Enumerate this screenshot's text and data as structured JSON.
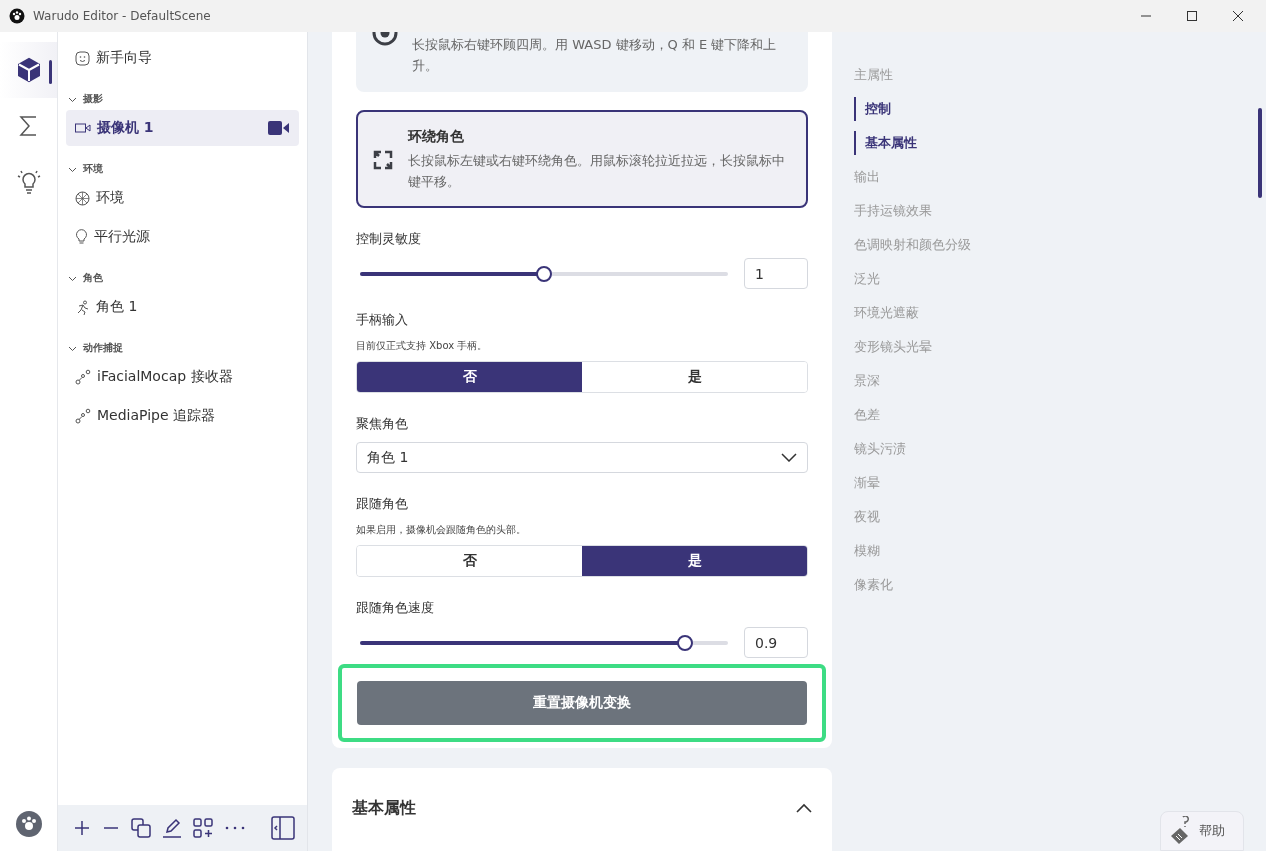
{
  "window": {
    "title": "Warudo Editor - DefaultScene"
  },
  "rail": [
    {
      "kind": "cube",
      "selected": true
    },
    {
      "kind": "sigma",
      "selected": false
    },
    {
      "kind": "bulb",
      "selected": false
    }
  ],
  "sidebar": {
    "top_item": {
      "label": "新手向导",
      "kind": "smile"
    },
    "groups": [
      {
        "label": "摄影",
        "expanded": true,
        "items": [
          {
            "label": "摄像机 1",
            "kind": "camera",
            "selected": true
          }
        ]
      },
      {
        "label": "环境",
        "expanded": true,
        "items": [
          {
            "label": "环境",
            "kind": "globe",
            "selected": false
          },
          {
            "label": "平行光源",
            "kind": "bulb",
            "selected": false
          }
        ]
      },
      {
        "label": "角色",
        "expanded": true,
        "items": [
          {
            "label": "角色 1",
            "kind": "runner",
            "selected": false
          }
        ]
      },
      {
        "label": "动作捕捉",
        "expanded": true,
        "items": [
          {
            "label": "iFacialMocap 接收器",
            "kind": "nodes",
            "selected": false
          },
          {
            "label": "MediaPipe 追踪器",
            "kind": "nodes",
            "selected": false
          }
        ]
      }
    ]
  },
  "control_modes": [
    {
      "kind": "eye",
      "description": "长按鼠标右键环顾四周。用 WASD 键移动，Q 和 E 键下降和上升。",
      "selected": false
    },
    {
      "kind": "orbit",
      "title": "环绕角色",
      "description": "长按鼠标左键或右键环绕角色。用鼠标滚轮拉近拉远，长按鼠标中键平移。",
      "selected": true
    }
  ],
  "settings": [
    {
      "kind": "slider",
      "label": "控制灵敏度",
      "level": 0.5,
      "value": "1"
    },
    {
      "kind": "toggle",
      "label": "手柄输入",
      "hint": "目前仅正式支持 Xbox 手柄。",
      "options": [
        {
          "label": "否",
          "selected": true
        },
        {
          "label": "是",
          "selected": false
        }
      ]
    },
    {
      "kind": "select",
      "label": "聚焦角色",
      "value": "角色 1"
    },
    {
      "kind": "toggle",
      "label": "跟随角色",
      "hint": "如果启用，摄像机会跟随角色的头部。",
      "options": [
        {
          "label": "否",
          "selected": false
        },
        {
          "label": "是",
          "selected": true
        }
      ]
    },
    {
      "kind": "slider",
      "label": "跟随角色速度",
      "level": 0.9,
      "value": "0.9"
    }
  ],
  "reset_button": {
    "label": "重置摄像机变换",
    "highlighted": true
  },
  "section": {
    "title": "基本属性",
    "expanded": true
  },
  "outline": [
    {
      "label": "主属性",
      "selected": false
    },
    {
      "label": "控制",
      "selected": true
    },
    {
      "label": "基本属性",
      "selected": true
    },
    {
      "label": "输出",
      "selected": false
    },
    {
      "label": "手持运镜效果",
      "selected": false
    },
    {
      "label": "色调映射和颜色分级",
      "selected": false
    },
    {
      "label": "泛光",
      "selected": false
    },
    {
      "label": "环境光遮蔽",
      "selected": false
    },
    {
      "label": "变形镜头光晕",
      "selected": false
    },
    {
      "label": "景深",
      "selected": false
    },
    {
      "label": "色差",
      "selected": false
    },
    {
      "label": "镜头污渍",
      "selected": false
    },
    {
      "label": "渐晕",
      "selected": false
    },
    {
      "label": "夜视",
      "selected": false
    },
    {
      "label": "模糊",
      "selected": false
    },
    {
      "label": "像素化",
      "selected": false
    }
  ],
  "help_button": {
    "label": "帮助"
  }
}
